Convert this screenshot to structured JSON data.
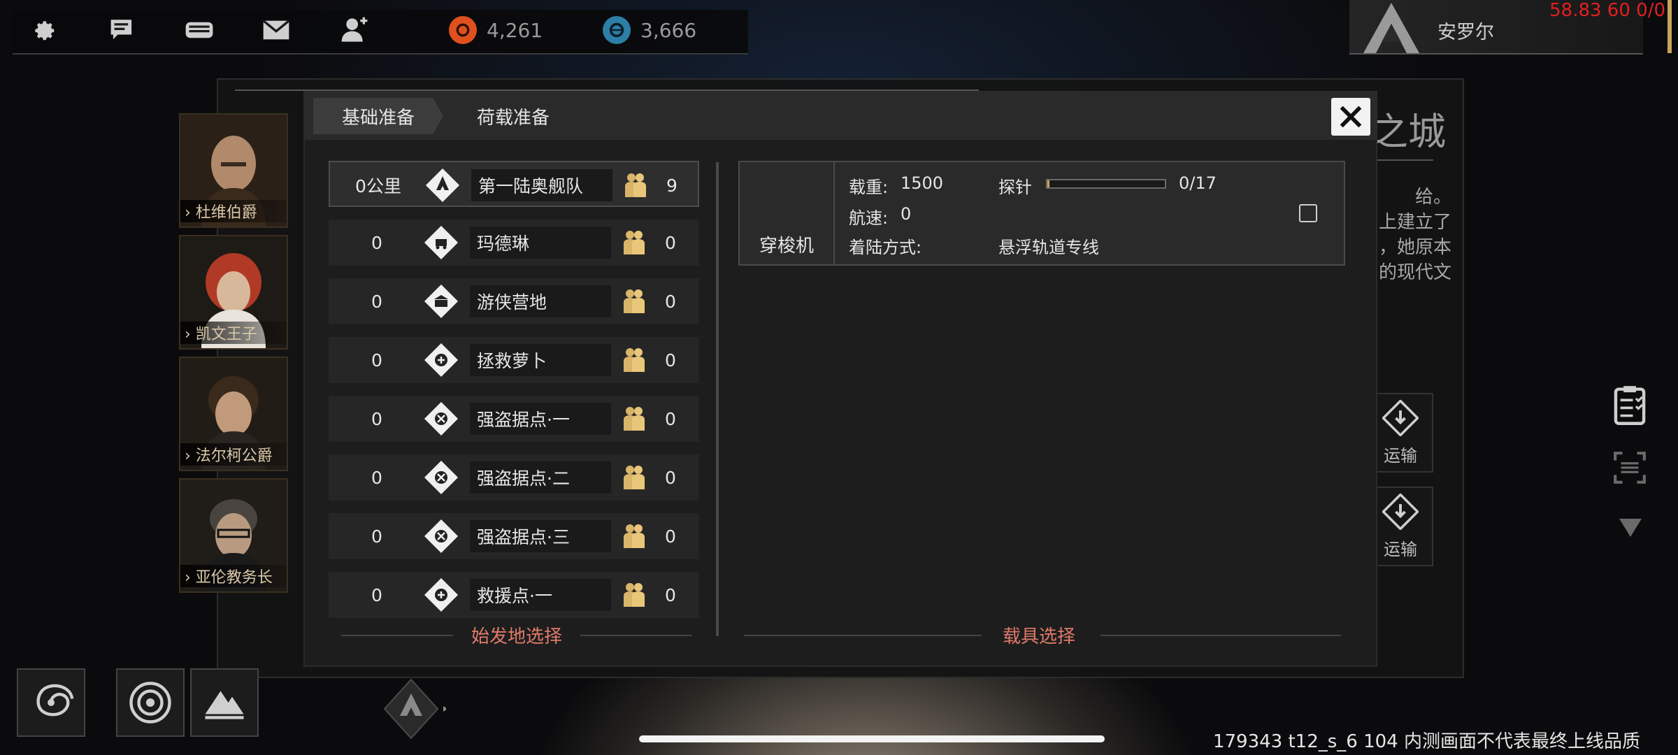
{
  "topbar": {
    "icons": [
      "gear-icon",
      "chat-icon",
      "gamepad-icon",
      "mail-icon",
      "add-friend-icon"
    ],
    "resources": [
      {
        "name": "orange-currency-icon",
        "value": "4,261",
        "color": "#e0501f"
      },
      {
        "name": "blue-currency-icon",
        "value": "3,666",
        "color": "#2d7fa7"
      }
    ],
    "player_name": "安罗尔",
    "fps": "58.83 60 0/0"
  },
  "background_panel": {
    "title_fragment": "之城",
    "text_lines": [
      "给。",
      "上建立了",
      "，她原本",
      "的现代文"
    ],
    "side_buttons": [
      {
        "label": "运输",
        "icon": "download-icon"
      },
      {
        "label": "运输",
        "icon": "download-icon"
      }
    ]
  },
  "characters": [
    {
      "name": "杜维伯爵"
    },
    {
      "name": "凯文王子"
    },
    {
      "name": "法尔柯公爵"
    },
    {
      "name": "亚伦教务长"
    }
  ],
  "dialog": {
    "tabs": [
      {
        "label": "基础准备",
        "active": true
      },
      {
        "label": "荷载准备",
        "active": false
      }
    ],
    "routes": [
      {
        "distance": "0公里",
        "name": "第一陆奥舰队",
        "count": "9",
        "icon": "arrow-up-icon",
        "selected": true
      },
      {
        "distance": "0",
        "name": "玛德琳",
        "count": "0",
        "icon": "vehicle-icon",
        "selected": false
      },
      {
        "distance": "0",
        "name": "游侠营地",
        "count": "0",
        "icon": "building-icon",
        "selected": false
      },
      {
        "distance": "0",
        "name": "拯救萝卜",
        "count": "0",
        "icon": "rescue-icon",
        "selected": false
      },
      {
        "distance": "0",
        "name": "强盗据点·一",
        "count": "0",
        "icon": "crossed-swords-icon",
        "selected": false
      },
      {
        "distance": "0",
        "name": "强盗据点·二",
        "count": "0",
        "icon": "crossed-swords-icon",
        "selected": false
      },
      {
        "distance": "0",
        "name": "强盗据点·三",
        "count": "0",
        "icon": "crossed-swords-icon",
        "selected": false
      },
      {
        "distance": "0",
        "name": "救援点·一",
        "count": "0",
        "icon": "rescue-icon",
        "selected": false
      }
    ],
    "origin_section_label": "始发地选择",
    "vehicle_section_label": "载具选择",
    "vehicle": {
      "name": "穿梭机",
      "load_label": "载重:",
      "load_value": "1500",
      "probe_label": "探针",
      "probe_value": "0/17",
      "probe_fraction": 0.02,
      "speed_label": "航速:",
      "speed_value": "0",
      "landing_label": "着陆方式:",
      "landing_value": "悬浮轨道专线"
    }
  },
  "right_rail_icons": [
    "clipboard-icon",
    "scan-icon",
    "triangle-down-icon"
  ],
  "bottom_buttons": [
    "galaxy-icon",
    "planet-icon",
    "mountain-icon"
  ],
  "watermark": "179343 t12_s_6 104  内测画面不代表最终上线品质"
}
